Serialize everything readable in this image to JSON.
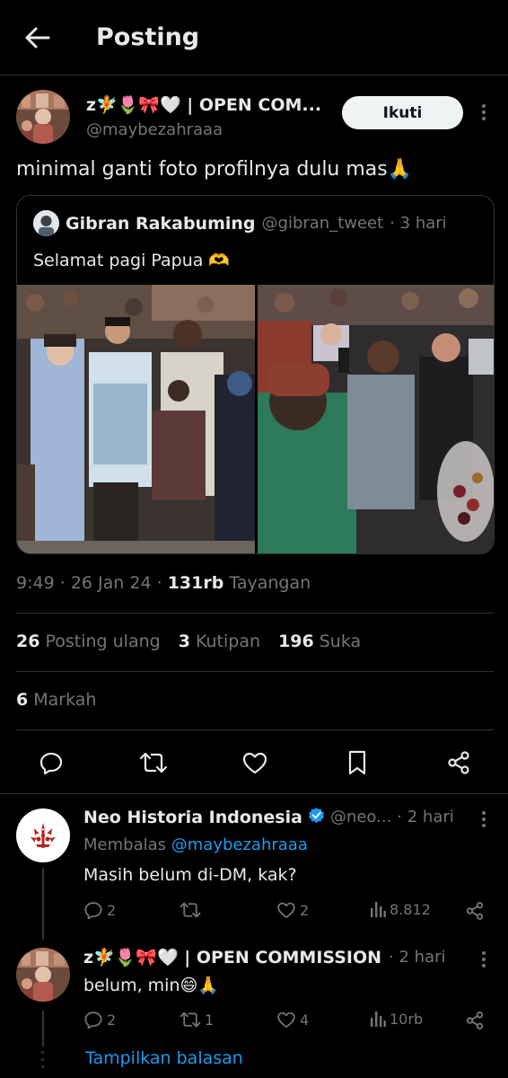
{
  "header": {
    "title": "Posting"
  },
  "post": {
    "author_name": "z🧚🌷🎀🤍 | OPEN COM...",
    "author_handle": "@maybezahraaa",
    "follow_label": "Ikuti",
    "text": "minimal ganti foto profilnya dulu mas🙏",
    "quote": {
      "author_name": "Gibran Rakabuming",
      "author_handle": "@gibran_tweet",
      "time": "· 3 hari",
      "text": "Selamat pagi Papua 🫶"
    },
    "meta": {
      "time": "9:49",
      "date": "26 Jan 24",
      "views_count": "131rb",
      "views_label": "Tayangan"
    },
    "stats": {
      "reposts_count": "26",
      "reposts_label": "Posting ulang",
      "quotes_count": "3",
      "quotes_label": "Kutipan",
      "likes_count": "196",
      "likes_label": "Suka",
      "bookmarks_count": "6",
      "bookmarks_label": "Markah"
    }
  },
  "replies": [
    {
      "author_name": "Neo Historia Indonesia",
      "author_handle": "@neo...",
      "time": "· 2 hari",
      "replying_prefix": "Membalas",
      "replying_to": "@maybezahraaa",
      "text": "Masih belum di-DM, kak?",
      "reply_count": "2",
      "repost_count": "",
      "like_count": "2",
      "views": "8.812"
    },
    {
      "author_name": "z🧚🌷🎀🤍 | OPEN COMMISSION",
      "time": "· 2 hari",
      "text": "belum, min😄🙏",
      "reply_count": "2",
      "repost_count": "1",
      "like_count": "4",
      "views": "10rb"
    }
  ],
  "show_replies_label": "Tampilkan balasan",
  "colors": {
    "background": "#000000",
    "accent": "#1d9bf0",
    "muted": "#71767b",
    "text": "#e7e9ea",
    "divider": "#2f3336"
  }
}
